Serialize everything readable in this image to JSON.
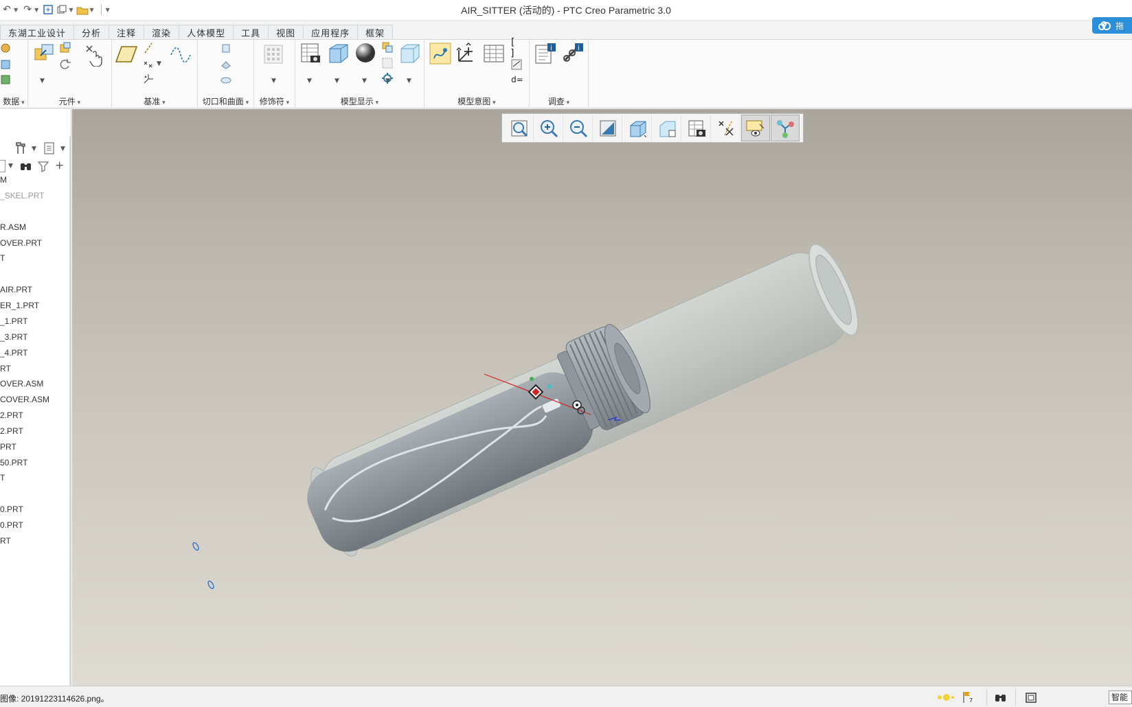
{
  "window": {
    "title": "AIR_SITTER (活动的) - PTC Creo Parametric 3.0",
    "cloud_label": "拖"
  },
  "ribbon": {
    "tabs": [
      "东湖工业设计",
      "分析",
      "注释",
      "渲染",
      "人体模型",
      "工具",
      "视图",
      "应用程序",
      "框架"
    ],
    "groups": {
      "data": "数据",
      "components": "元件",
      "datum": "基准",
      "cut_surface": "切口和曲面",
      "modifier": "修饰符",
      "model_display": "模型显示",
      "model_intent": "模型意图",
      "investigate": "调查"
    },
    "param_relation_label": "d="
  },
  "tree": {
    "items": [
      {
        "text": "M",
        "dim": false
      },
      {
        "text": "_SKEL.PRT",
        "dim": true
      },
      {
        "text": "R.ASM",
        "dim": false
      },
      {
        "text": "OVER.PRT",
        "dim": false
      },
      {
        "text": "T",
        "dim": false
      },
      {
        "text": "AIR.PRT",
        "dim": false
      },
      {
        "text": "ER_1.PRT",
        "dim": false
      },
      {
        "text": "_1.PRT",
        "dim": false
      },
      {
        "text": "_3.PRT",
        "dim": false
      },
      {
        "text": "_4.PRT",
        "dim": false
      },
      {
        "text": "RT",
        "dim": false
      },
      {
        "text": "OVER.ASM",
        "dim": false
      },
      {
        "text": "COVER.ASM",
        "dim": false
      },
      {
        "text": "2.PRT",
        "dim": false
      },
      {
        "text": "2.PRT",
        "dim": false
      },
      {
        "text": "PRT",
        "dim": false
      },
      {
        "text": "50.PRT",
        "dim": false
      },
      {
        "text": "T",
        "dim": false
      },
      {
        "text": "0.PRT",
        "dim": false
      },
      {
        "text": "0.PRT",
        "dim": false
      },
      {
        "text": "RT",
        "dim": false
      }
    ]
  },
  "status": {
    "message": "图像: 20191223114626.png。",
    "smart_label": "智能",
    "flag_count": "7"
  },
  "colors": {
    "accent": "#2b8fd9",
    "viewport_top": "#a9a59c",
    "viewport_bottom": "#dedbd3",
    "model_gray": "#8c9499",
    "shell_translucent": "#c8cdca"
  }
}
